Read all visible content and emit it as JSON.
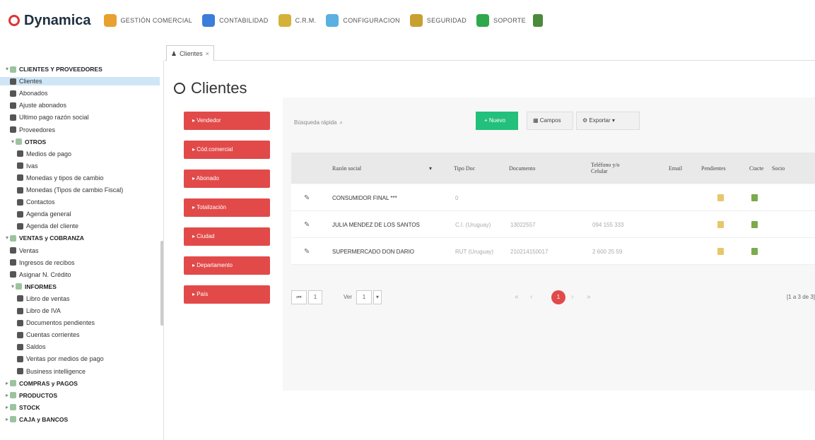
{
  "app": {
    "name": "Dynamica"
  },
  "topnav": [
    {
      "label": "GESTIÓN COMERCIAL",
      "icon": "commerce-icon",
      "color": "#e8a030"
    },
    {
      "label": "CONTABILIDAD",
      "icon": "accounting-icon",
      "color": "#3b7dd8"
    },
    {
      "label": "C.R.M.",
      "icon": "crm-icon",
      "color": "#d4b23a"
    },
    {
      "label": "CONFIGURACION",
      "icon": "config-icon",
      "color": "#5ab0e0"
    },
    {
      "label": "SEGURIDAD",
      "icon": "security-icon",
      "color": "#c8a030"
    },
    {
      "label": "SOPORTE",
      "icon": "support-icon",
      "color": "#2ea84a"
    }
  ],
  "sidebar": {
    "items": [
      {
        "label": "CLIENTES Y PROVEEDORES",
        "bold": true,
        "caret": "▾",
        "icon": "user-icon"
      },
      {
        "label": "Clientes",
        "selected": true,
        "icon": "user-icon"
      },
      {
        "label": "Abonados",
        "icon": "users-icon"
      },
      {
        "label": "Ajuste abonados",
        "icon": "user-icon"
      },
      {
        "label": "Ultimo pago razón social",
        "icon": "dollar-icon"
      },
      {
        "label": "Proveedores",
        "icon": "user-icon"
      },
      {
        "label": "OTROS",
        "bold": true,
        "caret": "▾",
        "icon": "folder-icon"
      },
      {
        "label": "Medios de pago",
        "icon": "card-icon"
      },
      {
        "label": "Ivas",
        "icon": "tag-icon"
      },
      {
        "label": "Monedas y tipos de cambio",
        "icon": "coin-icon"
      },
      {
        "label": "Monedas (Tipos de cambio Fiscal)",
        "icon": "coin-icon"
      },
      {
        "label": "Contactos",
        "icon": "user-icon"
      },
      {
        "label": "Agenda general",
        "icon": "info-icon"
      },
      {
        "label": "Agenda del cliente",
        "icon": "info-icon"
      },
      {
        "label": "VENTAS y COBRANZA",
        "bold": true,
        "caret": "▾",
        "icon": "sales-icon"
      },
      {
        "label": "Ventas",
        "icon": "cash-icon"
      },
      {
        "label": "Ingresos de recibos",
        "icon": "receipt-icon"
      },
      {
        "label": "Asignar N. Crédito",
        "icon": "book-icon"
      },
      {
        "label": "INFORMES",
        "bold": true,
        "caret": "▾",
        "icon": "folder-icon"
      },
      {
        "label": "Libro de ventas",
        "icon": "report-icon"
      },
      {
        "label": "Libro de IVA",
        "icon": "report-icon"
      },
      {
        "label": "Documentos pendientes",
        "icon": "report-icon"
      },
      {
        "label": "Cuentas corrientes",
        "icon": "report-icon"
      },
      {
        "label": "Saldos",
        "icon": "report-icon"
      },
      {
        "label": "Ventas por medios de pago",
        "icon": "report-icon"
      },
      {
        "label": "Business intelligence",
        "icon": "report-icon"
      },
      {
        "label": "COMPRAS y PAGOS",
        "bold": true,
        "caret": "▸",
        "icon": "purchase-icon"
      },
      {
        "label": "PRODUCTOS",
        "bold": true,
        "caret": "▸",
        "icon": "box-icon"
      },
      {
        "label": "STOCK",
        "bold": true,
        "caret": "▸",
        "icon": "stock-icon"
      },
      {
        "label": "CAJA y BANCOS",
        "bold": true,
        "caret": "▸",
        "icon": "bank-icon"
      }
    ]
  },
  "tab": {
    "label": "Clientes",
    "close": "×"
  },
  "page": {
    "title": "Clientes"
  },
  "filters": [
    "Vendedor",
    "Cód.comercial",
    "Abonado",
    "Totalización",
    "Ciudad",
    "Departamento",
    "País"
  ],
  "search": {
    "placeholder": "Búsqueda rápida"
  },
  "toolbar": {
    "new_label": "Nuevo",
    "fields_label": "Campos",
    "export_label": "Exportar"
  },
  "table": {
    "columns": [
      "Razón social",
      "Tipo Doc",
      "Documento",
      "Teléfono y/o Celular",
      "Email",
      "Pendientes",
      "Ctacte",
      "Socio"
    ],
    "rows": [
      {
        "name": "CONSUMIDOR FINAL ***",
        "doc_type": "0",
        "document": "",
        "phone": "",
        "email": ""
      },
      {
        "name": "JULIA MENDEZ DE LOS SANTOS",
        "doc_type": "C.I. (Uruguay)",
        "document": "13022557",
        "phone": "094 155 333",
        "email": ""
      },
      {
        "name": "SUPERMERCADO DON DARIO",
        "doc_type": "RUT (Uruguay)",
        "document": "210214150017",
        "phone": "2 600 25 59",
        "email": ""
      }
    ]
  },
  "pager": {
    "page": "1",
    "page_size_label": "Ver",
    "page_size": "1",
    "current": "1",
    "summary": "[1 a 3 de 3]"
  }
}
